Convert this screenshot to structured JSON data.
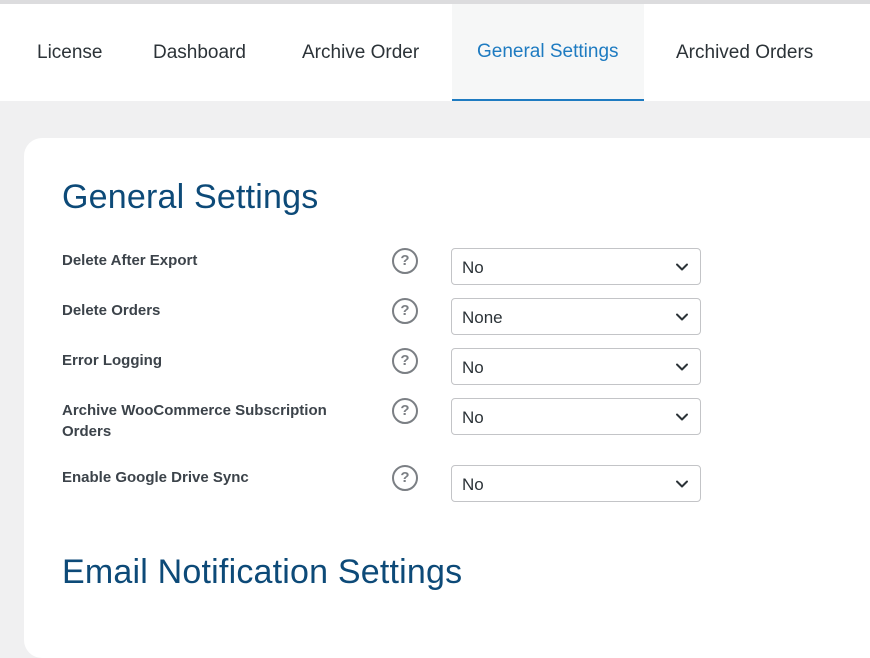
{
  "tabs": [
    {
      "label": "License"
    },
    {
      "label": "Dashboard"
    },
    {
      "label": "Archive Order"
    },
    {
      "label": "General Settings",
      "active": true
    },
    {
      "label": "Archived Orders"
    }
  ],
  "general": {
    "title": "General Settings",
    "rows": [
      {
        "label": "Delete After Export",
        "value": "No"
      },
      {
        "label": "Delete Orders",
        "value": "None"
      },
      {
        "label": "Error Logging",
        "value": "No"
      },
      {
        "label": "Archive WooCommerce Subscription Orders",
        "value": "No"
      },
      {
        "label": "Enable Google Drive Sync",
        "value": "No"
      }
    ],
    "help_glyph": "?"
  },
  "email": {
    "title": "Email Notification Settings"
  },
  "colors": {
    "accent": "#1e7bc1",
    "heading": "#0d4a78"
  },
  "icons": {
    "help": "question-circle-icon",
    "chevron": "chevron-down-icon"
  }
}
